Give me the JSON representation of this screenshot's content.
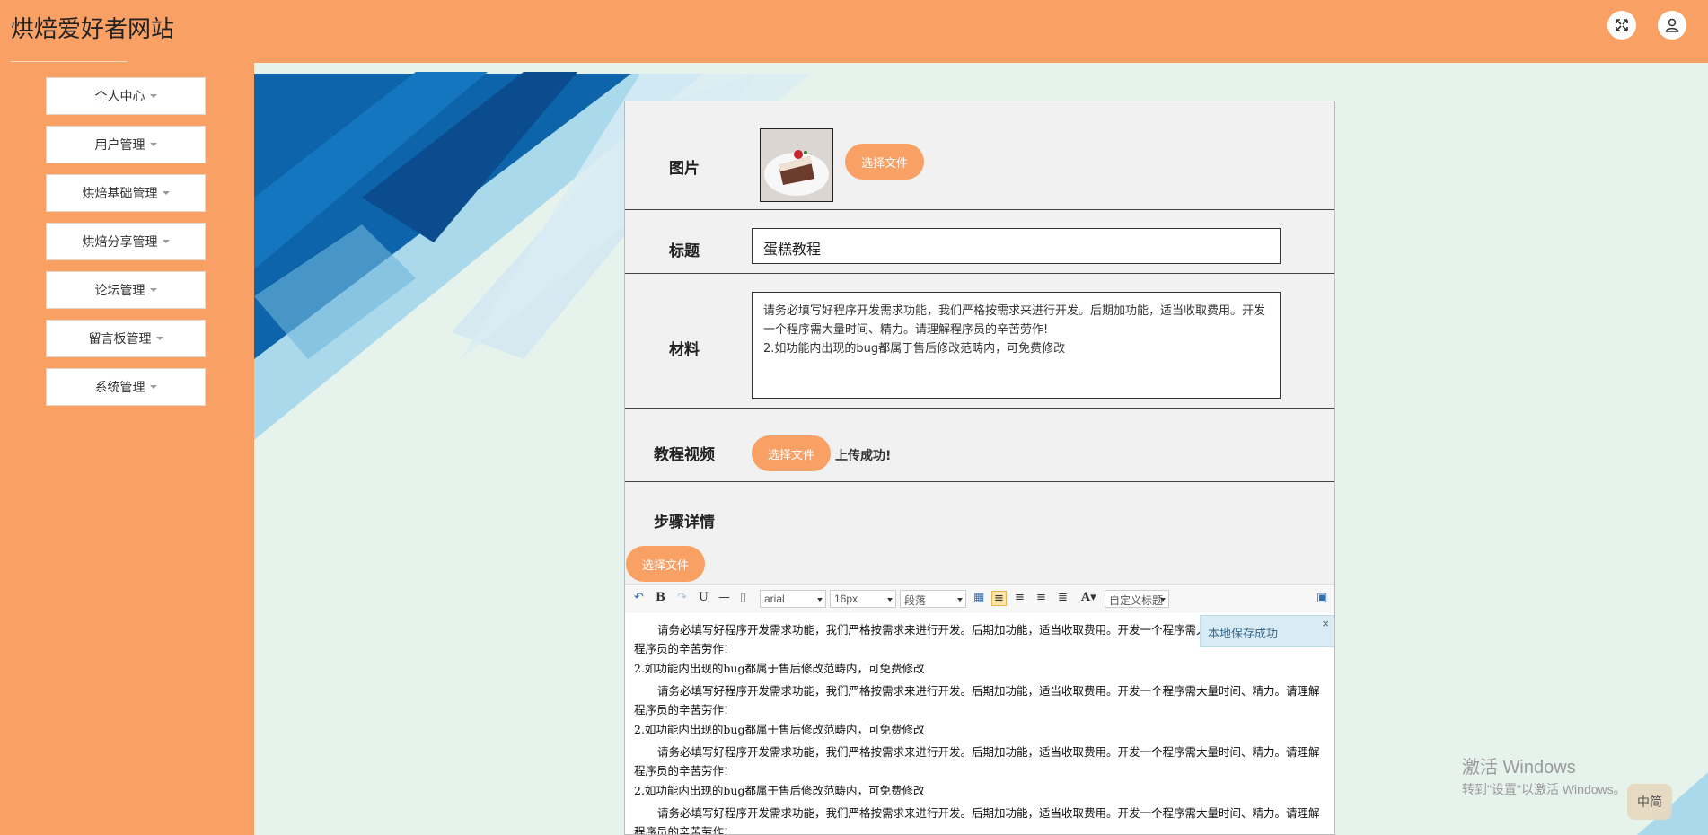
{
  "header": {
    "app_title": "烘焙爱好者网站",
    "fullscreen_icon": "fullscreen-icon",
    "user_icon": "user-icon"
  },
  "sidebar": {
    "items": [
      {
        "label": "个人中心"
      },
      {
        "label": "用户管理"
      },
      {
        "label": "烘焙基础管理"
      },
      {
        "label": "烘焙分享管理"
      },
      {
        "label": "论坛管理"
      },
      {
        "label": "留言板管理"
      },
      {
        "label": "系统管理"
      }
    ]
  },
  "form": {
    "image": {
      "label": "图片",
      "button": "选择文件"
    },
    "title": {
      "label": "标题",
      "value": "蛋糕教程"
    },
    "materials": {
      "label": "材料",
      "value": "请务必填写好程序开发需求功能，我们严格按需求来进行开发。后期加功能，适当收取费用。开发一个程序需大量时间、精力。请理解程序员的辛苦劳作!\n2.如功能内出现的bug都属于售后修改范畴内，可免费修改"
    },
    "video": {
      "label": "教程视频",
      "button": "选择文件",
      "status": "上传成功!"
    },
    "steps": {
      "label": "步骤详情",
      "button": "选择文件"
    }
  },
  "editor": {
    "toolbar": {
      "font_family": "arial",
      "font_size": "16px",
      "paragraph": "段落",
      "custom_title": "自定义标题"
    },
    "paragraphs": [
      {
        "text": "请务必填写好程序开发需求功能，我们严格按需求来进行开发。后期加功能，适当收取费用。开发一个程序需大量时间、精力。请理解程序员的辛苦劳作!",
        "indent": true
      },
      {
        "text": "2.如功能内出现的bug都属于售后修改范畴内，可免费修改",
        "indent": false
      },
      {
        "text": "请务必填写好程序开发需求功能，我们严格按需求来进行开发。后期加功能，适当收取费用。开发一个程序需大量时间、精力。请理解程序员的辛苦劳作!",
        "indent": true
      },
      {
        "text": "2.如功能内出现的bug都属于售后修改范畴内，可免费修改",
        "indent": false
      },
      {
        "text": "请务必填写好程序开发需求功能，我们严格按需求来进行开发。后期加功能，适当收取费用。开发一个程序需大量时间、精力。请理解程序员的辛苦劳作!",
        "indent": true
      },
      {
        "text": "2.如功能内出现的bug都属于售后修改范畴内，可免费修改",
        "indent": false
      },
      {
        "text": "请务必填写好程序开发需求功能，我们严格按需求来进行开发。后期加功能，适当收取费用。开发一个程序需大量时间、精力。请理解程序员的辛苦劳作!",
        "indent": true
      }
    ],
    "toast": "本地保存成功",
    "toast_close": "×"
  },
  "os_watermark": {
    "line1": "激活 Windows",
    "line2": "转到\"设置\"以激活 Windows。"
  },
  "ime_badge": "中简",
  "colors": {
    "accent": "#f9a065",
    "background": "#e6f2ec",
    "deco_blue": "#0a5fa8"
  }
}
